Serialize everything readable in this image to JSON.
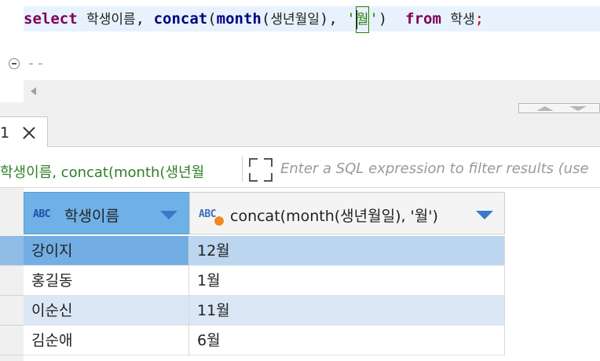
{
  "editor": {
    "sql_tokens": {
      "select": "select",
      "col1": "학생이름",
      "comma1": ",",
      "concat": "concat",
      "paren_open": "(",
      "month": "month",
      "paren2_open": "(",
      "col2": "생년월일",
      "paren2_close": ")",
      "comma2": ",",
      "quote_open": "'",
      "literal": "월",
      "quote_close": "'",
      "paren_close": ")",
      "from": "from",
      "table": "학생",
      "semicolon": ";"
    },
    "comment_line": "--"
  },
  "results": {
    "tab_number": "1",
    "filter_query": "학생이름, concat(month(생년월",
    "filter_placeholder": "Enter a SQL expression to filter results (use",
    "columns": [
      {
        "type_badge": "ABC",
        "label": "학생이름"
      },
      {
        "type_badge": "ABC",
        "label": "concat(month(생년월일), '월')"
      }
    ],
    "rows": [
      {
        "name": "강이지",
        "month": "12월"
      },
      {
        "name": "홍길동",
        "month": "1월"
      },
      {
        "name": "이순신",
        "month": "11월"
      },
      {
        "name": "김순애",
        "month": "6월"
      }
    ]
  },
  "colors": {
    "keyword": "#7f0055",
    "function": "#000080",
    "string": "#2a7f00",
    "selected_header": "#6fb0e6",
    "alt_row": "#dce7f5"
  }
}
